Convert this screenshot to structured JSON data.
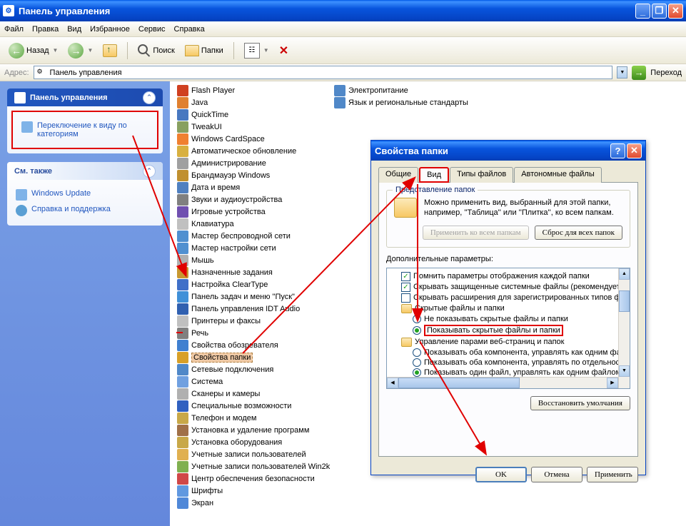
{
  "window": {
    "title": "Панель управления",
    "menu": [
      "Файл",
      "Правка",
      "Вид",
      "Избранное",
      "Сервис",
      "Справка"
    ],
    "toolbar": {
      "back": "Назад",
      "search": "Поиск",
      "folders": "Папки"
    },
    "addressbar": {
      "label": "Адрес:",
      "value": "Панель управления",
      "go": "Переход"
    },
    "controls": {
      "min": "_",
      "max": "❐",
      "close": "✕"
    }
  },
  "sidebar": {
    "panel_title": "Панель управления",
    "switch_link": "Переключение к виду по категориям",
    "see_also": "См. также",
    "links": [
      {
        "label": "Windows Update"
      },
      {
        "label": "Справка и поддержка"
      }
    ]
  },
  "content": {
    "col1": [
      "Flash Player",
      "Java",
      "QuickTime",
      "TweakUI",
      "Windows CardSpace",
      "Автоматическое обновление",
      "Администрирование",
      "Брандмауэр Windows",
      "Дата и время",
      "Звуки и аудиоустройства",
      "Игровые устройства",
      "Клавиатура",
      "Мастер беспроводной сети",
      "Мастер настройки сети",
      "Мышь",
      "Назначенные задания",
      "Настройка ClearType",
      "Панель задач и меню \"Пуск\"",
      "Панель управления IDT Audio",
      "Принтеры и факсы",
      "Речь",
      "Свойства обозревателя",
      "Свойства папки",
      "Сетевые подключения",
      "Система",
      "Сканеры и камеры",
      "Специальные возможности",
      "Телефон и модем",
      "Установка и удаление программ",
      "Установка оборудования",
      "Учетные записи пользователей",
      "Учетные записи пользователей Win2k",
      "Центр обеспечения безопасности",
      "Шрифты",
      "Экран"
    ],
    "col2": [
      "Электропитание",
      "Язык и региональные стандарты"
    ],
    "selected_index": 22,
    "icon_colors": [
      "#d04020",
      "#e08030",
      "#4878c0",
      "#88a060",
      "#f08030",
      "#d8b040",
      "#a0a0a0",
      "#c09030",
      "#5080c0",
      "#808080",
      "#7050b0",
      "#c0c0c0",
      "#5090d0",
      "#5090d0",
      "#b0b0b0",
      "#c89830",
      "#4070c8",
      "#4090d8",
      "#3060b0",
      "#c0c0c0",
      "#808080",
      "#4080d0",
      "#d8a028",
      "#5088c8",
      "#70a0e0",
      "#b0b0b0",
      "#3060c0",
      "#c8a848",
      "#a07048",
      "#c8a848",
      "#e0b050",
      "#80b050",
      "#d04848",
      "#6098e0",
      "#5088d8"
    ]
  },
  "dialog": {
    "title": "Свойства папки",
    "tabs": [
      "Общие",
      "Вид",
      "Типы файлов",
      "Автономные файлы"
    ],
    "active_tab": 1,
    "group1": {
      "title": "Представление папок",
      "text": "Можно применить вид, выбранный для этой папки, например, ''Таблица'' или ''Плитка'', ко всем папкам.",
      "btn_apply": "Применить ко всем папкам",
      "btn_reset": "Сброс для всех папок"
    },
    "advanced_label": "Дополнительные параметры:",
    "tree": [
      {
        "type": "check",
        "checked": true,
        "level": 1,
        "text": "Помнить параметры отображения каждой папки"
      },
      {
        "type": "check",
        "checked": true,
        "level": 1,
        "text": "Скрывать защищенные системные файлы (рекомендуется"
      },
      {
        "type": "check",
        "checked": false,
        "level": 1,
        "text": "Скрывать расширения для зарегистрированных типов фа"
      },
      {
        "type": "folder",
        "level": 1,
        "text": "Скрытые файлы и папки"
      },
      {
        "type": "radio",
        "checked": false,
        "level": 2,
        "text": "Не показывать скрытые файлы и папки"
      },
      {
        "type": "radio",
        "checked": true,
        "level": 2,
        "text": "Показывать скрытые файлы и папки",
        "highlight": true
      },
      {
        "type": "folder",
        "level": 1,
        "text": "Управление парами веб-страниц и папок"
      },
      {
        "type": "radio",
        "checked": false,
        "level": 2,
        "text": "Показывать оба компонента, управлять как одним фа"
      },
      {
        "type": "radio",
        "checked": false,
        "level": 2,
        "text": "Показывать оба компонента, управлять по отдельнос"
      },
      {
        "type": "radio",
        "checked": true,
        "level": 2,
        "text": "Показывать один файл, управлять как одним файлом"
      }
    ],
    "btn_restore": "Восстановить умолчания",
    "btn_ok": "OK",
    "btn_cancel": "Отмена",
    "btn_apply_dlg": "Применить"
  }
}
